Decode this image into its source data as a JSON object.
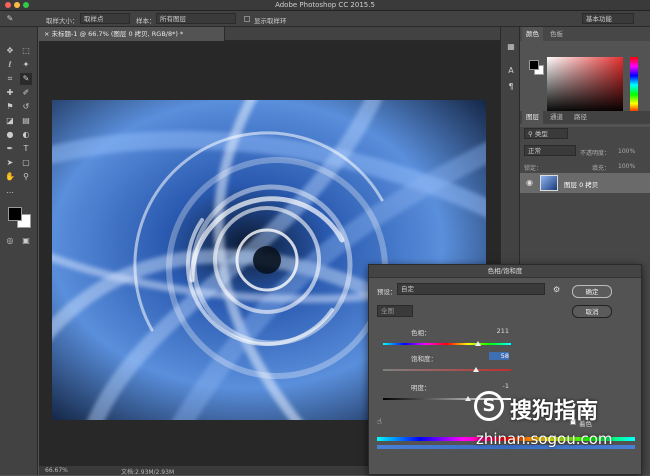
{
  "window": {
    "title": "Adobe Photoshop CC 2015.5"
  },
  "options_bar": {
    "sample_size_label": "取样大小：",
    "sample_size_value": "取样点",
    "sample_label": "样本：",
    "sample_value": "所有图层",
    "show_ring_label": "显示取样环",
    "workspace_value": "基本功能"
  },
  "document_tab": {
    "label": "未标题-1 @ 66.7% (图层 0 拷贝, RGB/8*) *"
  },
  "status_bar": {
    "zoom": "66.67%",
    "doc_size": "文档:2.93M/2.93M"
  },
  "colors": {
    "foreground": "#000000",
    "background": "#ffffff",
    "accent_blue": "#4a7fd6",
    "picker_red": "#e63030"
  },
  "color_panel": {
    "tabs": [
      "颜色",
      "色板"
    ]
  },
  "layers_panel": {
    "tabs": [
      "图层",
      "通道",
      "路径"
    ],
    "filter_value": "类型",
    "blend_mode": "正常",
    "opacity_label": "不透明度：",
    "opacity_value": "100%",
    "lock_label": "锁定：",
    "fill_label": "填充：",
    "fill_value": "100%",
    "layer_name": "图层 0 拷贝"
  },
  "dialog": {
    "title": "色相/饱和度",
    "preset_label": "预设：",
    "preset_value": "自定",
    "channel_value": "全图",
    "ok_label": "确定",
    "cancel_label": "取消",
    "hue_label": "色相：",
    "hue_value": "211",
    "saturation_label": "饱和度：",
    "saturation_value": "58",
    "lightness_label": "明度：",
    "lightness_value": "-1",
    "colorize_label": "着色"
  },
  "watermark": {
    "brand": "搜狗指南",
    "url": "zhinan.sogou.com"
  }
}
